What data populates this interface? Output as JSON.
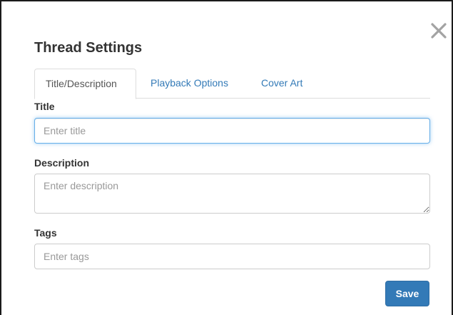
{
  "dialog": {
    "title": "Thread Settings",
    "close_icon": "close-icon"
  },
  "tabs": [
    {
      "label": "Title/Description",
      "active": true
    },
    {
      "label": "Playback Options",
      "active": false
    },
    {
      "label": "Cover Art",
      "active": false
    }
  ],
  "form": {
    "title": {
      "label": "Title",
      "placeholder": "Enter title",
      "value": ""
    },
    "description": {
      "label": "Description",
      "placeholder": "Enter description",
      "value": ""
    },
    "tags": {
      "label": "Tags",
      "placeholder": "Enter tags",
      "value": ""
    }
  },
  "actions": {
    "save_label": "Save"
  },
  "colors": {
    "accent": "#337ab7",
    "focus_border": "#66afe9",
    "title_text": "#333333",
    "close_icon": "#a3a3a3"
  }
}
